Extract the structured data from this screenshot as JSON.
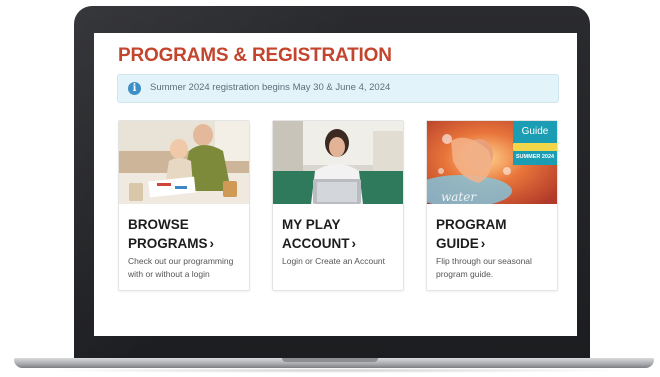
{
  "page": {
    "title": "PROGRAMS & REGISTRATION",
    "alert_text": "Summer 2024 registration begins May 30 & June 4, 2024",
    "alert_icon": "info-icon"
  },
  "cards": [
    {
      "title_line1": "BROWSE",
      "title_line2": "PROGRAMS",
      "description": "Check out our programming with or without a login",
      "image": "grandparent-and-child-drawing-photo"
    },
    {
      "title_line1": "MY PLAY",
      "title_line2": "ACCOUNT",
      "description": "Login or Create an Account",
      "image": "woman-using-laptop-photo"
    },
    {
      "title_line1": "PROGRAM",
      "title_line2": "GUIDE",
      "description": "Flip through our seasonal program guide.",
      "image": "summer-guide-cover-photo",
      "cover_label_top": "Guide",
      "cover_label_bottom": "SUMMER 2024",
      "cover_script": "water"
    }
  ],
  "chevron": "›",
  "colors": {
    "title": "#c4452d",
    "alert_bg": "#e3f3fa",
    "info_icon": "#3e8fc6",
    "laptop_frame": "#1f2023"
  }
}
